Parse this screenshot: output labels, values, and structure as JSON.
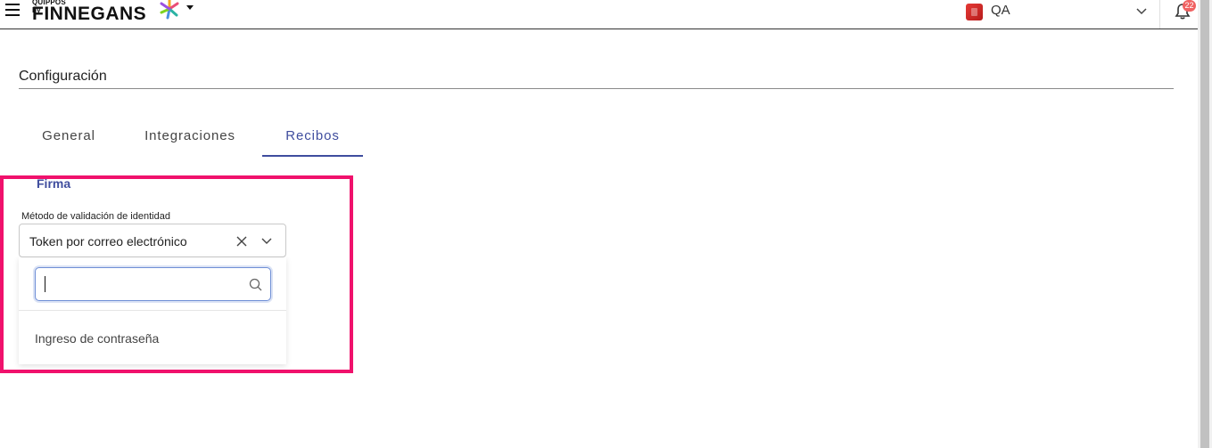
{
  "header": {
    "logo_small": "QUIPPOS by",
    "logo_main": "FINNEGANS",
    "company_name": "QA",
    "notification_count": "22"
  },
  "page": {
    "title": "Configuración"
  },
  "tabs": [
    {
      "label": "General"
    },
    {
      "label": "Integraciones"
    },
    {
      "label": "Recibos"
    }
  ],
  "active_tab": "Recibos",
  "section": {
    "title": "Firma",
    "field_label": "Método de validación de identidad",
    "selected_value": "Token por correo electrónico"
  },
  "dropdown": {
    "search_value": "",
    "options": [
      {
        "label": "Ingreso de contraseña"
      }
    ]
  },
  "colors": {
    "accent": "#3f4d9e",
    "highlight": "#f0116c",
    "badge": "#f06262"
  },
  "icons": [
    "menu-icon",
    "finnegans-star-icon",
    "caret-down-icon",
    "company-icon",
    "chevron-down-icon",
    "bell-icon",
    "close-icon",
    "search-icon"
  ]
}
